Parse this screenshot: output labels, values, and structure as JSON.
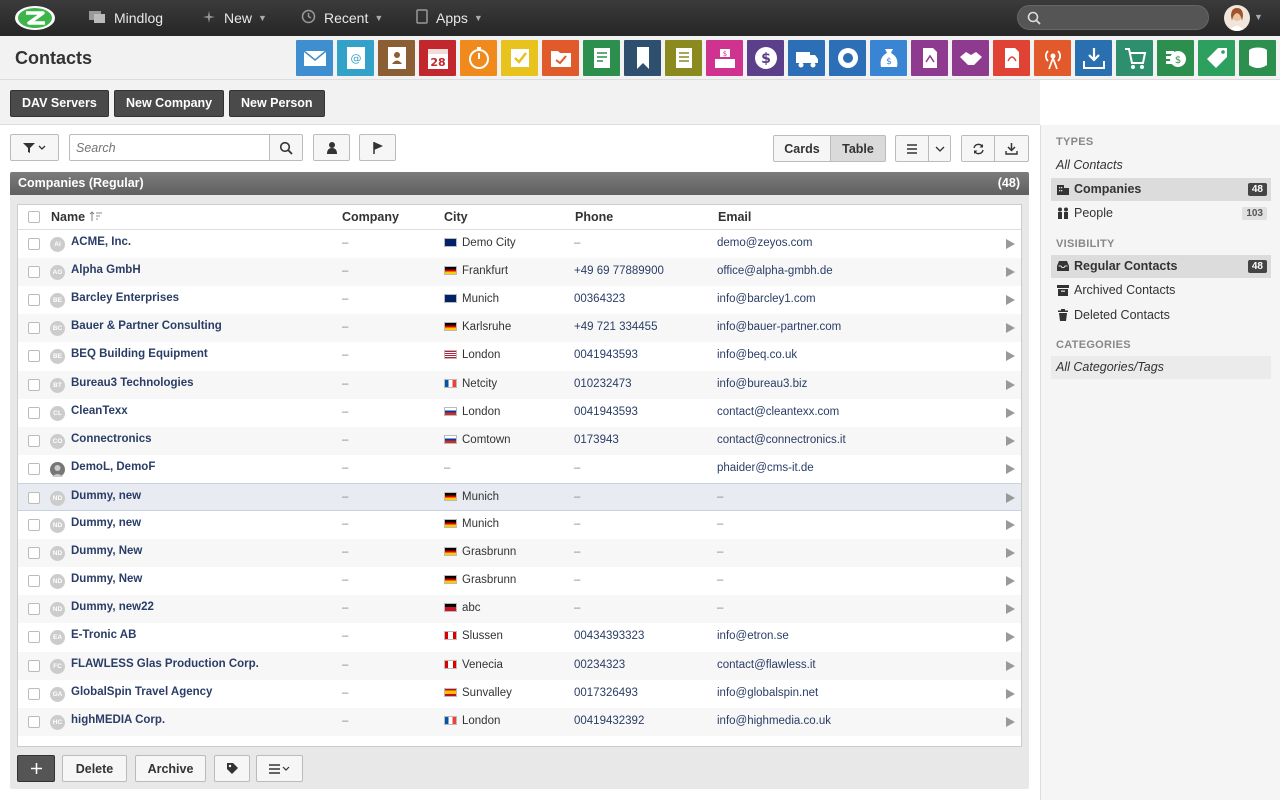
{
  "topnav": {
    "brand": "Mindlog",
    "new_label": "New",
    "recent_label": "Recent",
    "apps_label": "Apps",
    "search_placeholder": ""
  },
  "header": {
    "title": "Contacts"
  },
  "app_icons": [
    {
      "name": "mail-app-icon",
      "color": "#3e8ed0"
    },
    {
      "name": "address-book-app-icon",
      "color": "#33a2c8"
    },
    {
      "name": "contacts-card-app-icon",
      "color": "#8b5e34"
    },
    {
      "name": "calendar-app-icon",
      "color": "#c1272d",
      "day": "28"
    },
    {
      "name": "timer-app-icon",
      "color": "#f08a1c"
    },
    {
      "name": "tasks-app-icon",
      "color": "#e8c31d"
    },
    {
      "name": "folder-check-app-icon",
      "color": "#e05a2b"
    },
    {
      "name": "notes-app-icon",
      "color": "#2d8f4e"
    },
    {
      "name": "bookmark-app-icon",
      "color": "#2e4f6e"
    },
    {
      "name": "document-app-icon",
      "color": "#8a8a1e"
    },
    {
      "name": "cashdesk-app-icon",
      "color": "#d0338f"
    },
    {
      "name": "dollar-app-icon",
      "color": "#5b3f8a"
    },
    {
      "name": "delivery-app-icon",
      "color": "#2c6fb7"
    },
    {
      "name": "support-app-icon",
      "color": "#2c6fb7"
    },
    {
      "name": "money-bag-app-icon",
      "color": "#3a84d4"
    },
    {
      "name": "contract-app-icon",
      "color": "#8e3a8e"
    },
    {
      "name": "handshake-app-icon",
      "color": "#8e3a8e"
    },
    {
      "name": "pdf-app-icon",
      "color": "#e04333"
    },
    {
      "name": "broadcast-app-icon",
      "color": "#e25a2b"
    },
    {
      "name": "download-app-icon",
      "color": "#2a6fb0"
    },
    {
      "name": "cart-app-icon",
      "color": "#2d8f6e"
    },
    {
      "name": "cash-app-icon",
      "color": "#2d8f4e"
    },
    {
      "name": "price-tag-app-icon",
      "color": "#2d9f5e"
    },
    {
      "name": "database-app-icon",
      "color": "#2d8f4e"
    }
  ],
  "actions": {
    "dav_servers": "DAV Servers",
    "new_company": "New Company",
    "new_person": "New Person"
  },
  "toolbar": {
    "search_placeholder": "Search",
    "cards_label": "Cards",
    "table_label": "Table"
  },
  "panel": {
    "title": "Companies (Regular)",
    "count": "(48)"
  },
  "table": {
    "columns": [
      "Name",
      "Company",
      "City",
      "Phone",
      "Email"
    ],
    "rows": [
      {
        "initials": "AI",
        "name": "ACME, Inc.",
        "company": "–",
        "flag": "au",
        "city": "Demo City",
        "phone": "–",
        "email": "demo@zeyos.com"
      },
      {
        "initials": "AG",
        "name": "Alpha GmbH",
        "company": "–",
        "flag": "de",
        "city": "Frankfurt",
        "phone": "+49 69 77889900",
        "email": "office@alpha-gmbh.de"
      },
      {
        "initials": "BE",
        "name": "Barcley Enterprises",
        "company": "–",
        "flag": "gb",
        "city": "Munich",
        "phone": "00364323",
        "email": "info@barcley1.com"
      },
      {
        "initials": "BC",
        "name": "Bauer & Partner Consulting",
        "company": "–",
        "flag": "de",
        "city": "Karlsruhe",
        "phone": "+49 721 334455",
        "email": "info@bauer-partner.com"
      },
      {
        "initials": "BE",
        "name": "BEQ Building Equipment",
        "company": "–",
        "flag": "us",
        "city": "London",
        "phone": "0041943593",
        "email": "info@beq.co.uk"
      },
      {
        "initials": "BT",
        "name": "Bureau3 Technologies",
        "company": "–",
        "flag": "fr",
        "city": "Netcity",
        "phone": "010232473",
        "email": "info@bureau3.biz"
      },
      {
        "initials": "CL",
        "name": "CleanTexx",
        "company": "–",
        "flag": "ru",
        "city": "London",
        "phone": "0041943593",
        "email": "contact@cleantexx.com"
      },
      {
        "initials": "CO",
        "name": "Connectronics",
        "company": "–",
        "flag": "ru",
        "city": "Comtown",
        "phone": "0173943",
        "email": "contact@connectronics.it"
      },
      {
        "initials": "",
        "name": "DemoL, DemoF",
        "company": "–",
        "flag": "",
        "city": "–",
        "phone": "–",
        "email": "phaider@cms-it.de"
      },
      {
        "initials": "ND",
        "name": "Dummy, new",
        "company": "–",
        "flag": "de",
        "city": "Munich",
        "phone": "–",
        "email": "–"
      },
      {
        "initials": "ND",
        "name": "Dummy, new",
        "company": "–",
        "flag": "de",
        "city": "Munich",
        "phone": "–",
        "email": "–"
      },
      {
        "initials": "ND",
        "name": "Dummy, New",
        "company": "–",
        "flag": "de",
        "city": "Grasbrunn",
        "phone": "–",
        "email": "–"
      },
      {
        "initials": "ND",
        "name": "Dummy, New",
        "company": "–",
        "flag": "de",
        "city": "Grasbrunn",
        "phone": "–",
        "email": "–"
      },
      {
        "initials": "ND",
        "name": "Dummy, new22",
        "company": "–",
        "flag": "ag",
        "city": "abc",
        "phone": "–",
        "email": "–"
      },
      {
        "initials": "EA",
        "name": "E-Tronic AB",
        "company": "–",
        "flag": "ca",
        "city": "Slussen",
        "phone": "00434393323",
        "email": "info@etron.se"
      },
      {
        "initials": "FC",
        "name": "FLAWLESS Glas Production Corp.",
        "company": "–",
        "flag": "ca",
        "city": "Venecia",
        "phone": "00234323",
        "email": "contact@flawless.it"
      },
      {
        "initials": "GA",
        "name": "GlobalSpin Travel Agency",
        "company": "–",
        "flag": "es",
        "city": "Sunvalley",
        "phone": "0017326493",
        "email": "info@globalspin.net"
      },
      {
        "initials": "HC",
        "name": "highMEDIA Corp.",
        "company": "–",
        "flag": "fr",
        "city": "London",
        "phone": "00419432392",
        "email": "info@highmedia.co.uk"
      }
    ]
  },
  "bottom": {
    "delete_label": "Delete",
    "archive_label": "Archive"
  },
  "sidebar": {
    "types_heading": "TYPES",
    "all_contacts": "All Contacts",
    "companies": "Companies",
    "companies_count": "48",
    "people": "People",
    "people_count": "103",
    "visibility_heading": "VISIBILITY",
    "regular": "Regular Contacts",
    "regular_count": "48",
    "archived": "Archived Contacts",
    "deleted": "Deleted Contacts",
    "categories_heading": "CATEGORIES",
    "all_categories": "All Categories/Tags"
  }
}
